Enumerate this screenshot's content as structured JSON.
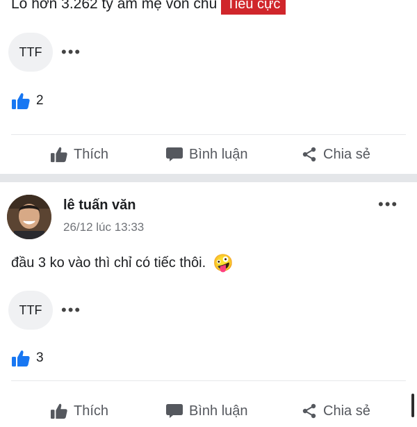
{
  "post1": {
    "text": "Lỗ hơn 3.262 tỷ âm mẹ vốn chủ",
    "badge": "Tiêu cực",
    "tag": "TTF",
    "more": "•••",
    "like_count": "2"
  },
  "actions": {
    "like": "Thích",
    "comment": "Bình luận",
    "share": "Chia sẻ"
  },
  "post2": {
    "author": "lê tuấn văn",
    "timestamp": "26/12 lúc 13:33",
    "more": "•••",
    "body": "đầu 3 ko vào thì chỉ có tiếc thôi.",
    "emoji": "🤪",
    "tag": "TTF",
    "tag_more": "•••",
    "like_count": "3"
  },
  "colors": {
    "like_blue": "#1877f2",
    "badge_red": "#d0262b",
    "muted_gray": "#55585e"
  },
  "icons": [
    "thumbs-up-icon",
    "comment-icon",
    "share-icon",
    "more-icon"
  ]
}
